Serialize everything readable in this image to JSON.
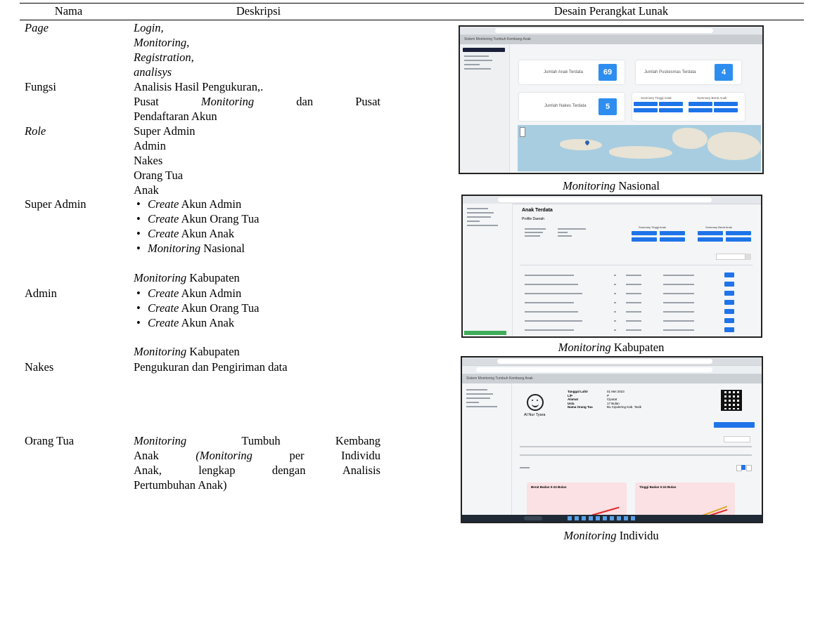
{
  "headers": {
    "nama": "Nama",
    "deskripsi": "Deskripsi",
    "desain": "Desain Perangkat Lunak"
  },
  "page": {
    "name": "Page",
    "items": [
      "Login,",
      "Monitoring,",
      "Registration,",
      "analisys"
    ]
  },
  "fungsi": {
    "name": "Fungsi",
    "line1": "Analisis Hasil Pengukuran,.",
    "line2_words": [
      "Pusat",
      "Monitoring",
      "dan",
      "Pusat"
    ],
    "line3": "Pendaftaran Akun"
  },
  "role": {
    "name": "Role",
    "items": [
      "Super Admin",
      "Admin",
      "Nakes",
      "Orang Tua",
      "Anak"
    ]
  },
  "super_admin": {
    "name": "Super Admin",
    "create": "Create",
    "bullets": [
      "Akun Admin",
      "Akun Orang Tua",
      "Akun Anak"
    ],
    "monitoring_word": "Monitoring",
    "nasional": "Nasional",
    "kabupaten": "Kabupaten"
  },
  "admin": {
    "name": "Admin",
    "create": "Create",
    "bullets": [
      "Akun Admin",
      "Akun Orang Tua",
      "Akun Anak"
    ],
    "monitoring_word": "Monitoring",
    "kabupaten": "Kabupaten"
  },
  "nakes": {
    "name": "Nakes",
    "desc": "Pengukuran dan Pengiriman data"
  },
  "orang_tua": {
    "name": "Orang Tua",
    "line1_words": [
      "Monitoring",
      "Tumbuh",
      "Kembang"
    ],
    "line2_words": [
      "Anak",
      "(Monitoring",
      "per",
      "Individu"
    ],
    "line3_words": [
      "Anak,",
      "lengkap",
      "dengan",
      "Analisis"
    ],
    "line4": "Pertumbuhan Anak)"
  },
  "captions": {
    "monitoring_word": "Monitoring",
    "nasional": "Nasional",
    "kabupaten": "Kabupaten",
    "individu": "Individu"
  },
  "screens": {
    "nasional": {
      "app_title": "Sistem Monitoring Tumbuh Kembang Anak",
      "cards": [
        {
          "label": "Jumlah Anak Terdata",
          "value": "69"
        },
        {
          "label": "Jumlah Puskesmas Terdata",
          "value": "4"
        },
        {
          "label": "Jumlah Nakes Terdata",
          "value": "5"
        }
      ],
      "summary_tinggi": "Summary Tinggi Anak",
      "summary_berat": "Summary Berat Anak"
    },
    "kabupaten": {
      "title": "Anak Terdata",
      "subtitle": "Profile Daerah",
      "summary_tinggi": "Summary Tinggi Anak",
      "summary_berat": "Summary Berat Anak"
    },
    "individu": {
      "app_title": "Sistem Monitoring Tumbuh Kembang Anak",
      "child_name": "Al Nur Tyara",
      "fields": [
        {
          "k": "Tanggal Lahir",
          "v": "01 Mei 2023"
        },
        {
          "k": "L/P",
          "v": "P"
        },
        {
          "k": "Alamat",
          "v": "Ciputat"
        },
        {
          "k": "Usia",
          "v": "17 Bulan"
        },
        {
          "k": "Nama Orang Tua",
          "v": "Bu Cipulering Kab. Tasik"
        }
      ],
      "chart1": "Berat Badan 0-24 Bulan",
      "chart2": "Tinggi Badan 0-24 Bulan"
    }
  }
}
